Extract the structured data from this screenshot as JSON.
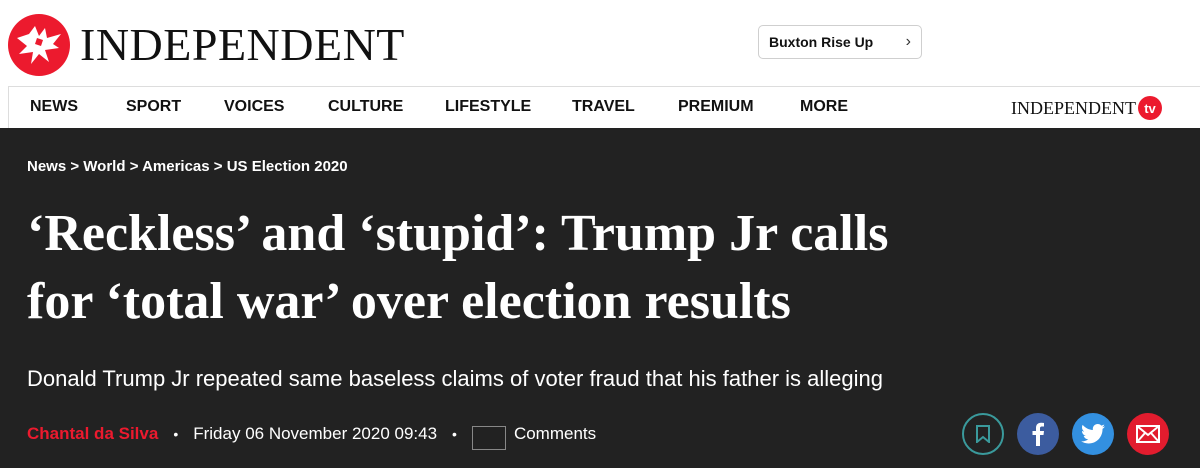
{
  "brand": {
    "wordmark": "INDEPENDENT",
    "tv_word": "INDEPENDENT",
    "tv_badge": "tv",
    "accent_color": "#ec1a2e"
  },
  "promo": {
    "label": "Buxton Rise Up",
    "chevron": "›"
  },
  "nav": {
    "items": [
      "NEWS",
      "SPORT",
      "VOICES",
      "CULTURE",
      "LIFESTYLE",
      "TRAVEL",
      "PREMIUM",
      "MORE"
    ]
  },
  "article": {
    "breadcrumb": [
      "News",
      "World",
      "Americas",
      "US Election 2020"
    ],
    "breadcrumb_separator": ">",
    "headline_line1": "‘Reckless’ and ‘stupid’: Trump Jr calls",
    "headline_line2": "for ‘total war’ over election results",
    "standfirst": "Donald Trump Jr repeated same baseless claims of voter fraud that his father is alleging",
    "author": "Chantal da Silva",
    "date": "Friday 06 November 2020 09:43",
    "bullet": "•",
    "comments_label": "Comments"
  },
  "share": {
    "icons": [
      "bookmark-icon",
      "facebook-icon",
      "twitter-icon",
      "email-icon"
    ],
    "colors": {
      "bookmark": "#3a9a9c",
      "facebook": "#3c5c9f",
      "twitter": "#3390e0",
      "email": "#e21c2e"
    }
  },
  "colors": {
    "header_background": "#222222",
    "text_on_dark": "#ffffff"
  }
}
